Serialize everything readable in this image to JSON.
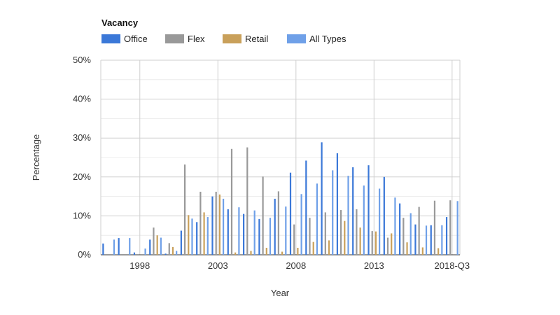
{
  "chart_data": {
    "type": "bar",
    "title": "Vacancy",
    "xlabel": "Year",
    "ylabel": "Percentage",
    "ylim": [
      0,
      50
    ],
    "y_ticks": [
      "0%",
      "10%",
      "20%",
      "30%",
      "40%",
      "50%"
    ],
    "x_tick_labels": [
      "1998",
      "2003",
      "2008",
      "2013",
      "2018-Q3"
    ],
    "legend_placement": "top-left",
    "grid": true,
    "categories": [
      "1996",
      "1997",
      "1998",
      "1999",
      "2000",
      "2001",
      "2002",
      "2003",
      "2004",
      "2005",
      "2006",
      "2007",
      "2008",
      "2009",
      "2010",
      "2011",
      "2012",
      "2013",
      "2014",
      "2015",
      "2016",
      "2017",
      "2018-Q3"
    ],
    "series": [
      {
        "name": "Office",
        "color": "#3b78d8",
        "values": [
          2.9,
          4.3,
          0.6,
          3.9,
          0.3,
          6.2,
          8.4,
          15.0,
          11.7,
          10.5,
          9.2,
          14.4,
          21.1,
          24.2,
          28.9,
          26.1,
          22.5,
          23.0,
          20.0,
          13.2,
          7.8,
          7.6,
          9.7
        ]
      },
      {
        "name": "Flex",
        "color": "#999999",
        "values": [
          0,
          0,
          0,
          7.0,
          3.0,
          23.2,
          16.2,
          16.2,
          27.2,
          27.6,
          20.1,
          16.3,
          7.8,
          9.5,
          10.9,
          11.5,
          11.7,
          6.1,
          4.4,
          9.5,
          12.3,
          13.9,
          14.0
        ]
      },
      {
        "name": "Retail",
        "color": "#c9a05a",
        "values": [
          0,
          0,
          0,
          5.0,
          2.0,
          10.2,
          10.9,
          15.5,
          0.6,
          1.0,
          1.8,
          0.8,
          1.8,
          3.3,
          3.7,
          8.7,
          7.0,
          6.0,
          5.5,
          3.2,
          1.9,
          1.7,
          0
        ]
      },
      {
        "name": "All Types",
        "color": "#6fa0e8",
        "values": [
          3.9,
          4.3,
          1.6,
          4.4,
          1.0,
          9.3,
          9.7,
          14.4,
          12.2,
          11.4,
          9.5,
          12.4,
          15.6,
          18.3,
          21.7,
          20.3,
          17.8,
          17.0,
          14.7,
          10.7,
          7.5,
          7.6,
          13.8
        ]
      }
    ]
  }
}
